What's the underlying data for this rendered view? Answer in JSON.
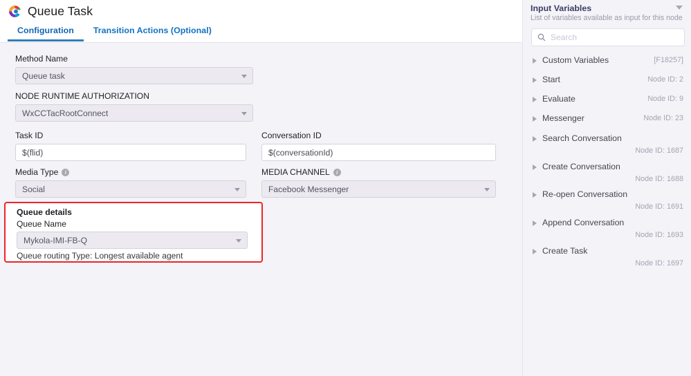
{
  "header": {
    "icon": "cisco-webex-logo-icon",
    "title": "Queue Task",
    "tabs": [
      {
        "label": "Configuration",
        "active": true
      },
      {
        "label": "Transition Actions (Optional)",
        "active": false
      }
    ]
  },
  "form": {
    "method_name": {
      "label": "Method Name",
      "value": "Queue task",
      "type": "select"
    },
    "node_runtime_authorization": {
      "label": "NODE RUNTIME AUTHORIZATION",
      "value": "WxCCTacRootConnect",
      "type": "select"
    },
    "task_id": {
      "label": "Task ID",
      "value": "$(flid)",
      "type": "input"
    },
    "conversation_id": {
      "label": "Conversation ID",
      "value": "$(conversationId)",
      "type": "input"
    },
    "media_type": {
      "label": "Media Type",
      "value": "Social",
      "type": "select",
      "info": true
    },
    "media_channel": {
      "label": "MEDIA CHANNEL",
      "value": "Facebook Messenger",
      "type": "select",
      "info": true
    }
  },
  "queue_details": {
    "heading": "Queue details",
    "queue_name_label": "Queue Name",
    "queue_name_value": "Mykola-IMI-FB-Q",
    "routing_text": "Queue routing Type: Longest available agent",
    "highlight_color": "#e8262b"
  },
  "sidebar": {
    "title": "Input Variables",
    "subtitle": "List of variables available as input for this node",
    "collapse_icon": "chevron-down-icon",
    "search": {
      "icon": "search-icon",
      "placeholder": "Search",
      "value": ""
    },
    "items": [
      {
        "label": "Custom Variables",
        "id": "[F18257]",
        "wrapped": false
      },
      {
        "label": "Start",
        "id": "Node ID: 2",
        "wrapped": false
      },
      {
        "label": "Evaluate",
        "id": "Node ID: 9",
        "wrapped": false
      },
      {
        "label": "Messenger",
        "id": "Node ID: 23",
        "wrapped": false
      },
      {
        "label": "Search Conversation",
        "id": "Node ID: 1687",
        "wrapped": true
      },
      {
        "label": "Create Conversation",
        "id": "Node ID: 1688",
        "wrapped": true
      },
      {
        "label": "Re-open Conversation",
        "id": "Node ID: 1691",
        "wrapped": true
      },
      {
        "label": "Append Conversation",
        "id": "Node ID: 1693",
        "wrapped": true
      },
      {
        "label": "Create Task",
        "id": "Node ID: 1697",
        "wrapped": true
      }
    ]
  },
  "colors": {
    "accent_blue": "#1271c4",
    "page_background": "#f4f3f8",
    "highlight_red": "#e8262b"
  }
}
